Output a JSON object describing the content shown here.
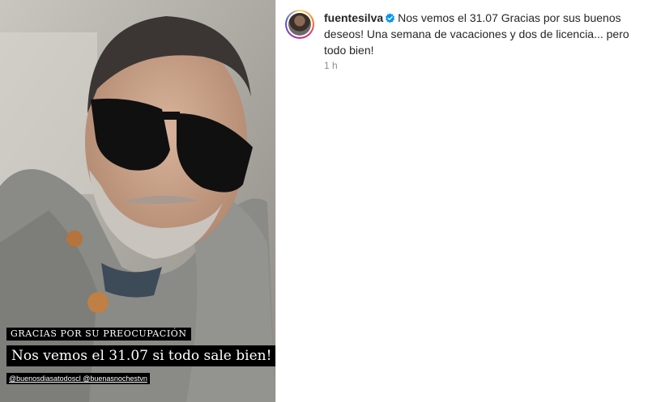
{
  "post": {
    "username": "fuentesilva",
    "caption": "Nos vemos el 31.07 Gracias por sus buenos deseos! Una semana de vacaciones y dos de licencia... pero todo bien!",
    "time": "1 h",
    "verified_icon": "verified-badge-icon"
  },
  "media": {
    "overlay_title": "GRACIAS POR SU PREOCUPACIÓN",
    "overlay_main": "Nos vemos el 31.07 si todo sale bien!",
    "overlay_tags": "@buenosdiasatodoscl @buenasnochestvn"
  },
  "colors": {
    "verified": "#0095f6",
    "text": "#262626",
    "muted": "#8e8e8e"
  }
}
